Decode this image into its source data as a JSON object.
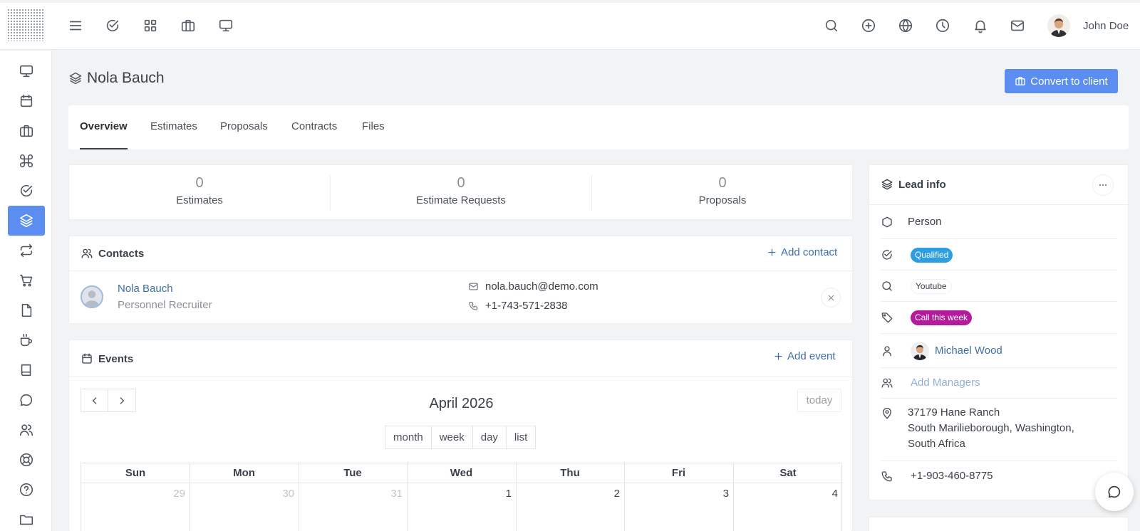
{
  "user": {
    "name": "John Doe"
  },
  "page": {
    "title": "Nola Bauch",
    "convert_label": "Convert to client"
  },
  "tabs": [
    "Overview",
    "Estimates",
    "Proposals",
    "Contracts",
    "Files"
  ],
  "stats": [
    {
      "value": "0",
      "label": "Estimates"
    },
    {
      "value": "0",
      "label": "Estimate Requests"
    },
    {
      "value": "0",
      "label": "Proposals"
    }
  ],
  "contacts": {
    "title": "Contacts",
    "add_label": "Add contact",
    "items": [
      {
        "name": "Nola Bauch",
        "role": "Personnel Recruiter",
        "email": "nola.bauch@demo.com",
        "phone": "+1-743-571-2838"
      }
    ]
  },
  "events": {
    "title": "Events",
    "add_label": "Add event",
    "month_title": "April 2026",
    "today_label": "today",
    "views": [
      "month",
      "week",
      "day",
      "list"
    ],
    "weekdays": [
      "Sun",
      "Mon",
      "Tue",
      "Wed",
      "Thu",
      "Fri",
      "Sat"
    ],
    "first_week": [
      "29",
      "30",
      "31",
      "1",
      "2",
      "3",
      "4"
    ]
  },
  "lead_info": {
    "title": "Lead info",
    "type": "Person",
    "status": "Qualified",
    "source": "Youtube",
    "label": "Call this week",
    "owner": "Michael Wood",
    "add_managers_label": "Add Managers",
    "address_line1": "37179 Hane Ranch",
    "address_line2": "South Marilieborough, Washington,",
    "address_line3": "South Africa",
    "phone": "+1-903-460-8775"
  },
  "colors": {
    "accent": "#5b8ef0",
    "status_qualified": "#2d9fe0",
    "label_call": "#b41b9c",
    "link": "#3d6fa8"
  }
}
